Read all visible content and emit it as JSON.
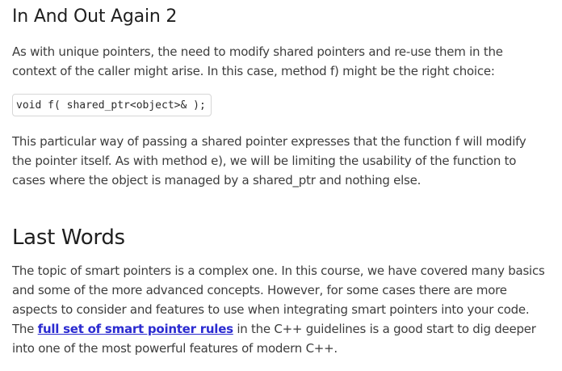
{
  "section1": {
    "heading": "In And Out Again 2",
    "paragraph1": "As with unique pointers, the need to modify shared pointers and re-use them in the context of the caller might arise. In this case, method f) might be the right choice:",
    "code": "void f( shared_ptr<object>& );",
    "paragraph2": "This particular way of passing a shared pointer expresses that the function f will modify the pointer itself. As with method e), we will be limiting the usability of the function to cases where the object is managed by a shared_ptr and nothing else."
  },
  "section2": {
    "heading": "Last Words",
    "paragraph_before_link": "The topic of smart pointers is a complex one. In this course, we have covered many basics and some of the more advanced concepts. However, for some cases there are more aspects to consider and features to use when integrating smart pointers into your code. The ",
    "link_text": "full set of smart pointer rules",
    "paragraph_after_link": " in the C++ guidelines is a good start to dig deeper into one of the most powerful features of modern C++."
  },
  "colors": {
    "text": "#3d3d3d",
    "heading": "#1f1f1f",
    "link": "#2a2ad0",
    "code_border": "#d6d6d6"
  }
}
